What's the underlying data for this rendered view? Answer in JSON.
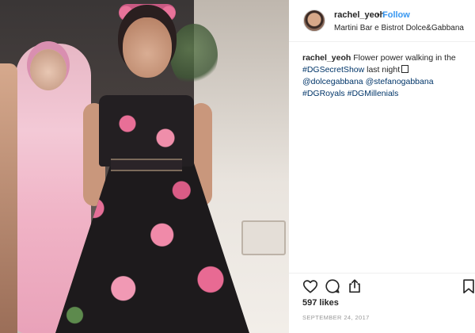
{
  "post": {
    "username": "rachel_yeoh",
    "separator": "•",
    "follow_label": "Follow",
    "location": "Martini Bar e Bistrot Dolce&Gabbana",
    "caption": {
      "username": "rachel_yeoh",
      "text1": " Flower power walking in the ",
      "tag1": "#DGSecretShow",
      "text2": " last night",
      "mention1": "@dolcegabbana",
      "mention2": "@stefanogabbana",
      "tag2": "#DGRoyals",
      "tag3": "#DGMillenials"
    },
    "likes": "597 likes",
    "date": "SEPTEMBER 24, 2017"
  },
  "icons": {
    "like": "heart-icon",
    "comment": "comment-icon",
    "share": "share-icon",
    "save": "bookmark-icon"
  },
  "colors": {
    "link": "#3897f0",
    "hashtag": "#003569",
    "text": "#262626",
    "muted": "#999999"
  }
}
